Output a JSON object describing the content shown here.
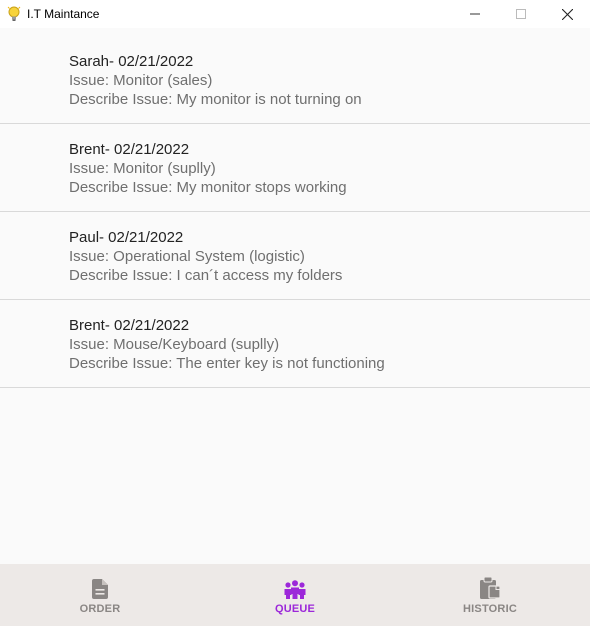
{
  "window": {
    "title": "I.T Maintance",
    "icon": "lightbulb-icon",
    "controls": [
      "minimize-icon",
      "maximize-icon",
      "close-icon"
    ]
  },
  "tickets": [
    {
      "title": "Sarah- 02/21/2022",
      "issue": "Issue: Monitor (sales)",
      "description": "Describe Issue: My monitor is not turning on"
    },
    {
      "title": "Brent- 02/21/2022",
      "issue": "Issue: Monitor (suplly)",
      "description": "Describe Issue: My monitor stops working"
    },
    {
      "title": "Paul- 02/21/2022",
      "issue": "Issue: Operational System (logistic)",
      "description": "Describe Issue: I can´t access my folders"
    },
    {
      "title": "Brent- 02/21/2022",
      "issue": "Issue: Mouse/Keyboard (suplly)",
      "description": "Describe Issue: The enter key is not functioning"
    }
  ],
  "bottom_nav": {
    "items": [
      {
        "label": "ORDER",
        "icon": "document-icon",
        "active": false
      },
      {
        "label": "QUEUE",
        "icon": "people-group-icon",
        "active": true
      },
      {
        "label": "HISTORIC",
        "icon": "clipboard-icon",
        "active": false
      }
    ],
    "active_color": "#9c27d9",
    "inactive_color": "#8a8684"
  }
}
